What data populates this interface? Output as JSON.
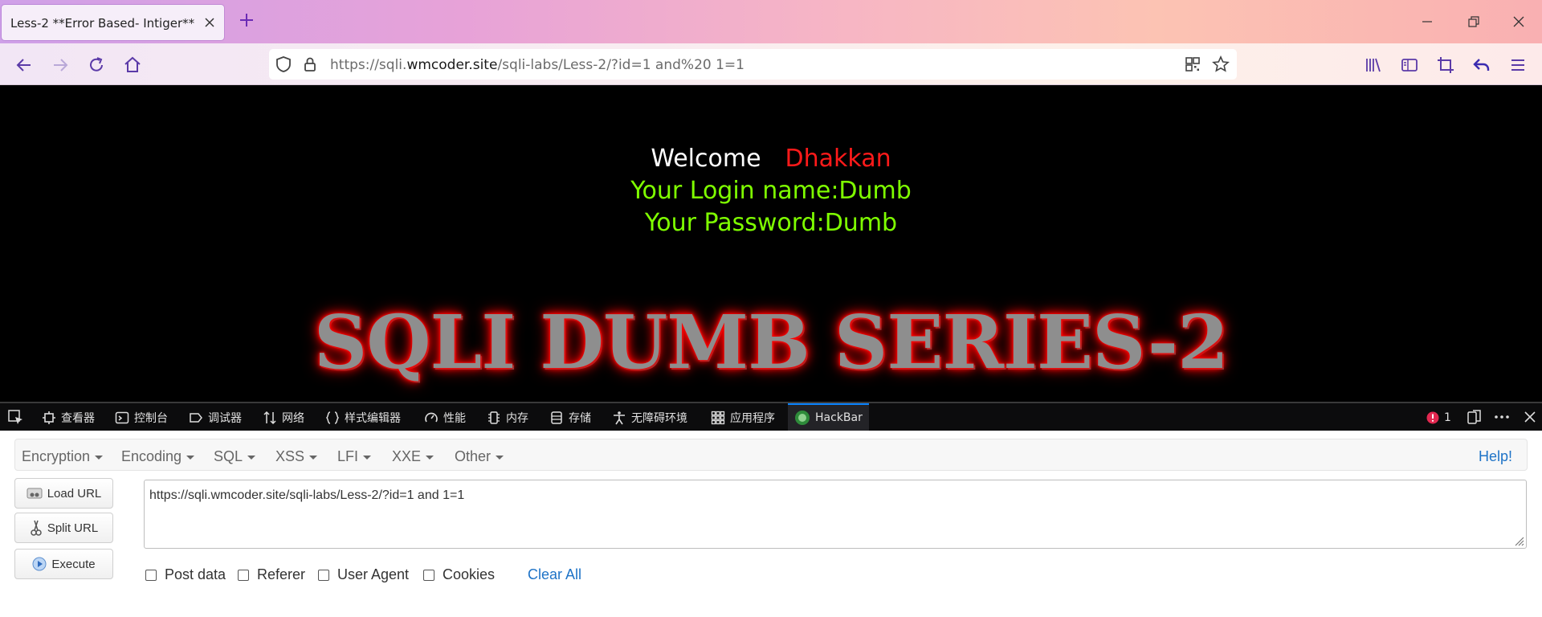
{
  "browser": {
    "tab_title": "Less-2 **Error Based- Intiger**",
    "url_prefix": "https://sqli.",
    "url_host": "wmcoder.site",
    "url_path": "/sqli-labs/Less-2/?id=1 and%20 1=1"
  },
  "page": {
    "welcome_label": "Welcome",
    "welcome_name": "Dhakkan",
    "login_line": "Your Login name:Dumb",
    "password_line": "Your Password:Dumb",
    "banner": "SQLI DUMB SERIES-2"
  },
  "devtools": {
    "tabs": [
      "查看器",
      "控制台",
      "调试器",
      "网络",
      "样式编辑器",
      "性能",
      "内存",
      "存储",
      "无障碍环境",
      "应用程序",
      "HackBar"
    ],
    "error_count": "1"
  },
  "hackbar": {
    "menu": [
      "Encryption",
      "Encoding",
      "SQL",
      "XSS",
      "LFI",
      "XXE",
      "Other"
    ],
    "help": "Help!",
    "buttons": {
      "load": "Load URL",
      "split": "Split URL",
      "execute": "Execute"
    },
    "url_value": "https://sqli.wmcoder.site/sqli-labs/Less-2/?id=1 and  1=1",
    "checkboxes": [
      "Post data",
      "Referer",
      "User Agent",
      "Cookies"
    ],
    "clear_all": "Clear All"
  },
  "colors": {
    "welcome_name": "#ff1a1a",
    "green_text": "#7fff00",
    "link_blue": "#1e73c7",
    "devtools_accent": "#0a84ff"
  }
}
